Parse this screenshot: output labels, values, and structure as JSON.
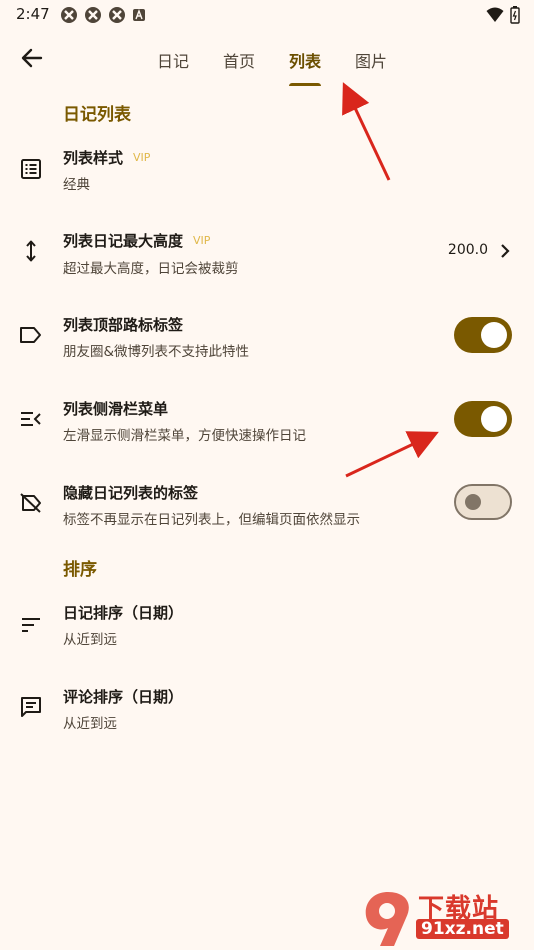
{
  "status_bar": {
    "time": "2:47",
    "left_icons": [
      "app-icon",
      "app-icon",
      "app-icon",
      "a-badge-icon"
    ],
    "right_icons": [
      "wifi-icon",
      "battery-icon"
    ]
  },
  "app_bar": {
    "back_icon": "arrow-left-icon",
    "tabs": [
      {
        "label": "日记",
        "active": false
      },
      {
        "label": "首页",
        "active": false
      },
      {
        "label": "列表",
        "active": true
      },
      {
        "label": "图片",
        "active": false
      }
    ]
  },
  "sections": {
    "diary_list": "日记列表",
    "sort": "排序"
  },
  "items": {
    "list_style": {
      "title": "列表样式",
      "badge": "VIP",
      "subtitle": "经典",
      "icon": "list-icon"
    },
    "max_height": {
      "title": "列表日记最大高度",
      "badge": "VIP",
      "subtitle": "超过最大高度，日记会被裁剪",
      "value": "200.0",
      "icon": "vertical-arrows-icon"
    },
    "top_tags": {
      "title": "列表顶部路标标签",
      "subtitle": "朋友圈&微博列表不支持此特性",
      "switch_on": true,
      "icon": "label-icon"
    },
    "side_menu": {
      "title": "列表侧滑栏菜单",
      "subtitle": "左滑显示侧滑栏菜单，方便快速操作日记",
      "switch_on": true,
      "icon": "menu-open-icon"
    },
    "hide_tags": {
      "title": "隐藏日记列表的标签",
      "subtitle": "标签不再显示在日记列表上，但编辑页面依然显示",
      "switch_on": false,
      "icon": "label-off-icon"
    },
    "diary_sort": {
      "title": "日记排序（日期）",
      "subtitle": "从近到远",
      "icon": "sort-icon"
    },
    "comment_sort": {
      "title": "评论排序（日期）",
      "subtitle": "从近到远",
      "icon": "comment-icon"
    }
  },
  "watermark": {
    "logo_text": "下载站",
    "url": "91xz.net"
  },
  "colors": {
    "background": "#FFF8F2",
    "accent": "#7A5900",
    "vip": "#E0B84A",
    "annotation_arrow": "#D9261C"
  }
}
